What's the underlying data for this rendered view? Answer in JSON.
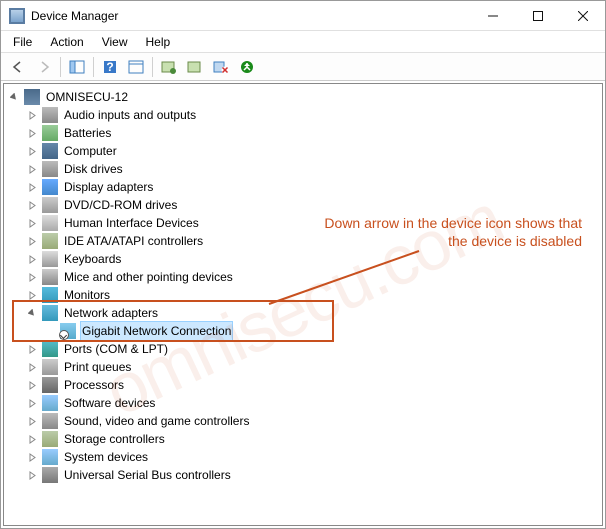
{
  "window": {
    "title": "Device Manager"
  },
  "menu": {
    "file": "File",
    "action": "Action",
    "view": "View",
    "help": "Help"
  },
  "tree": {
    "root": "OMNISECU-12",
    "items": [
      "Audio inputs and outputs",
      "Batteries",
      "Computer",
      "Disk drives",
      "Display adapters",
      "DVD/CD-ROM drives",
      "Human Interface Devices",
      "IDE ATA/ATAPI controllers",
      "Keyboards",
      "Mice and other pointing devices",
      "Monitors",
      "Network adapters",
      "Ports (COM & LPT)",
      "Print queues",
      "Processors",
      "Software devices",
      "Sound, video and game controllers",
      "Storage controllers",
      "System devices",
      "Universal Serial Bus controllers"
    ],
    "network_child": "Gigabit Network Connection"
  },
  "annotation": {
    "text": "Down arrow in the device icon shows that\nthe device is disabled",
    "watermark": "omnisecu.com"
  }
}
